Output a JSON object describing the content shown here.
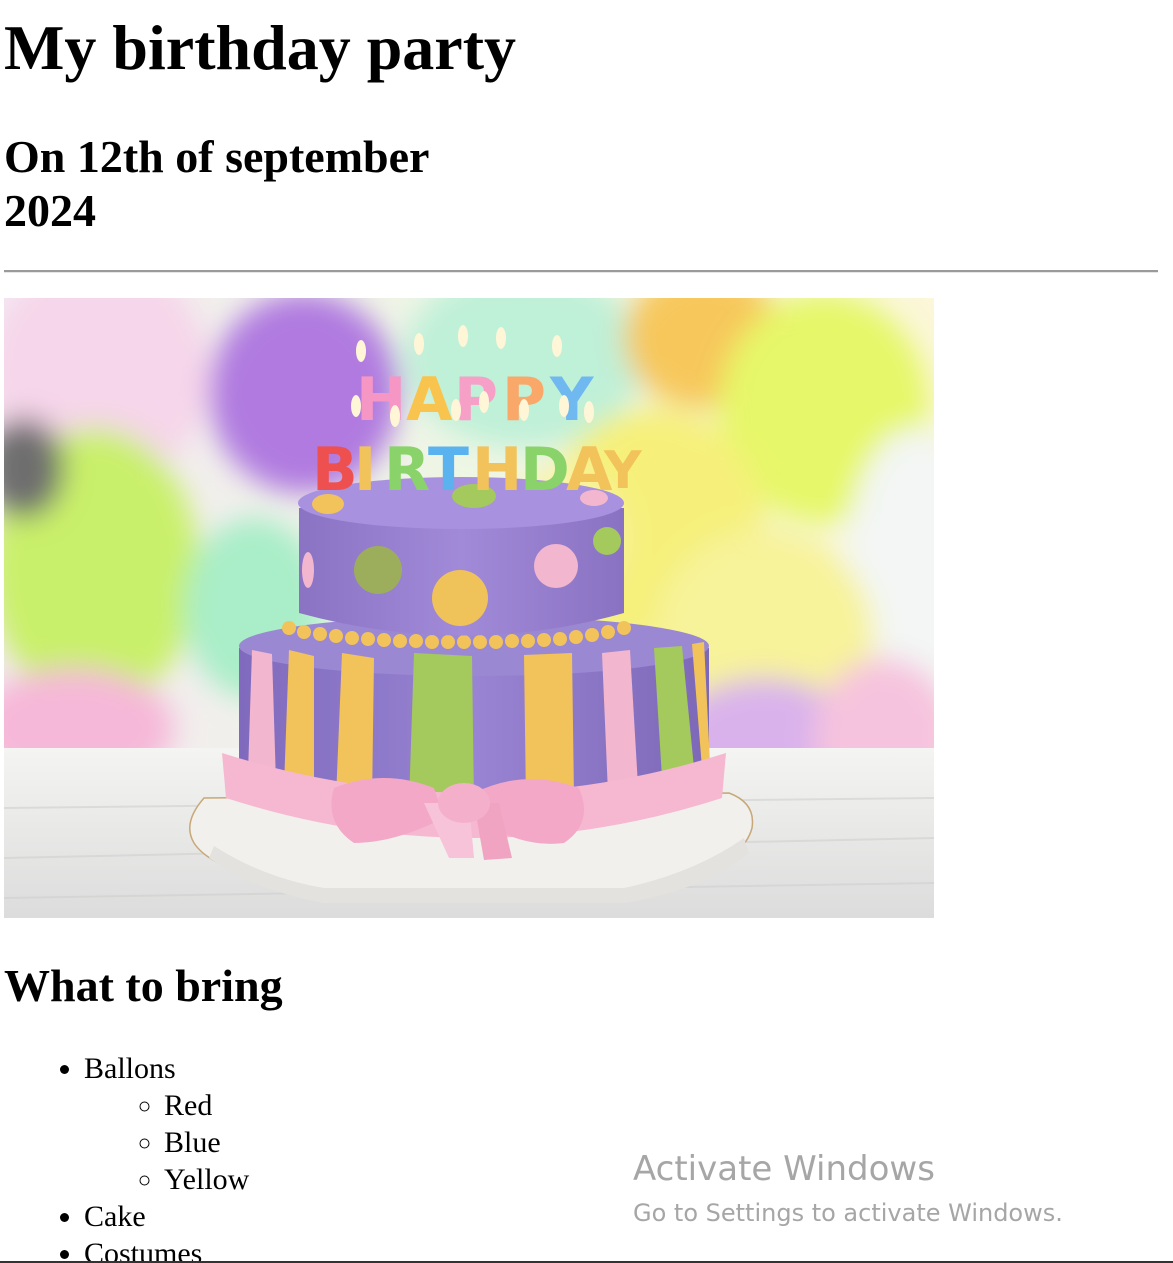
{
  "page": {
    "title": "My birthday party",
    "date_heading": "On 12th of september 2024"
  },
  "image": {
    "subject": "birthday-cake",
    "candle_text_top": "HAPPY",
    "candle_text_bottom": "BIRTHDAY"
  },
  "bring": {
    "heading": "What to bring",
    "items": [
      {
        "label": "Ballons",
        "subitems": [
          "Red",
          "Blue",
          "Yellow"
        ]
      },
      {
        "label": "Cake",
        "subitems": []
      },
      {
        "label": "Costumes",
        "subitems": []
      }
    ]
  },
  "watermark": {
    "title": "Activate Windows",
    "subtitle": "Go to Settings to activate Windows."
  },
  "colors": {
    "divider": "#9a9a9a",
    "watermark": "#a6a6a6",
    "cake_top": "#9d86d4",
    "cake_bottom": "#8f7ccc",
    "stripe_yellow": "#f2c35a",
    "stripe_green": "#a4c95c",
    "stripe_pink": "#f3b6cf",
    "ribbon_pink": "#f5b8d0"
  }
}
